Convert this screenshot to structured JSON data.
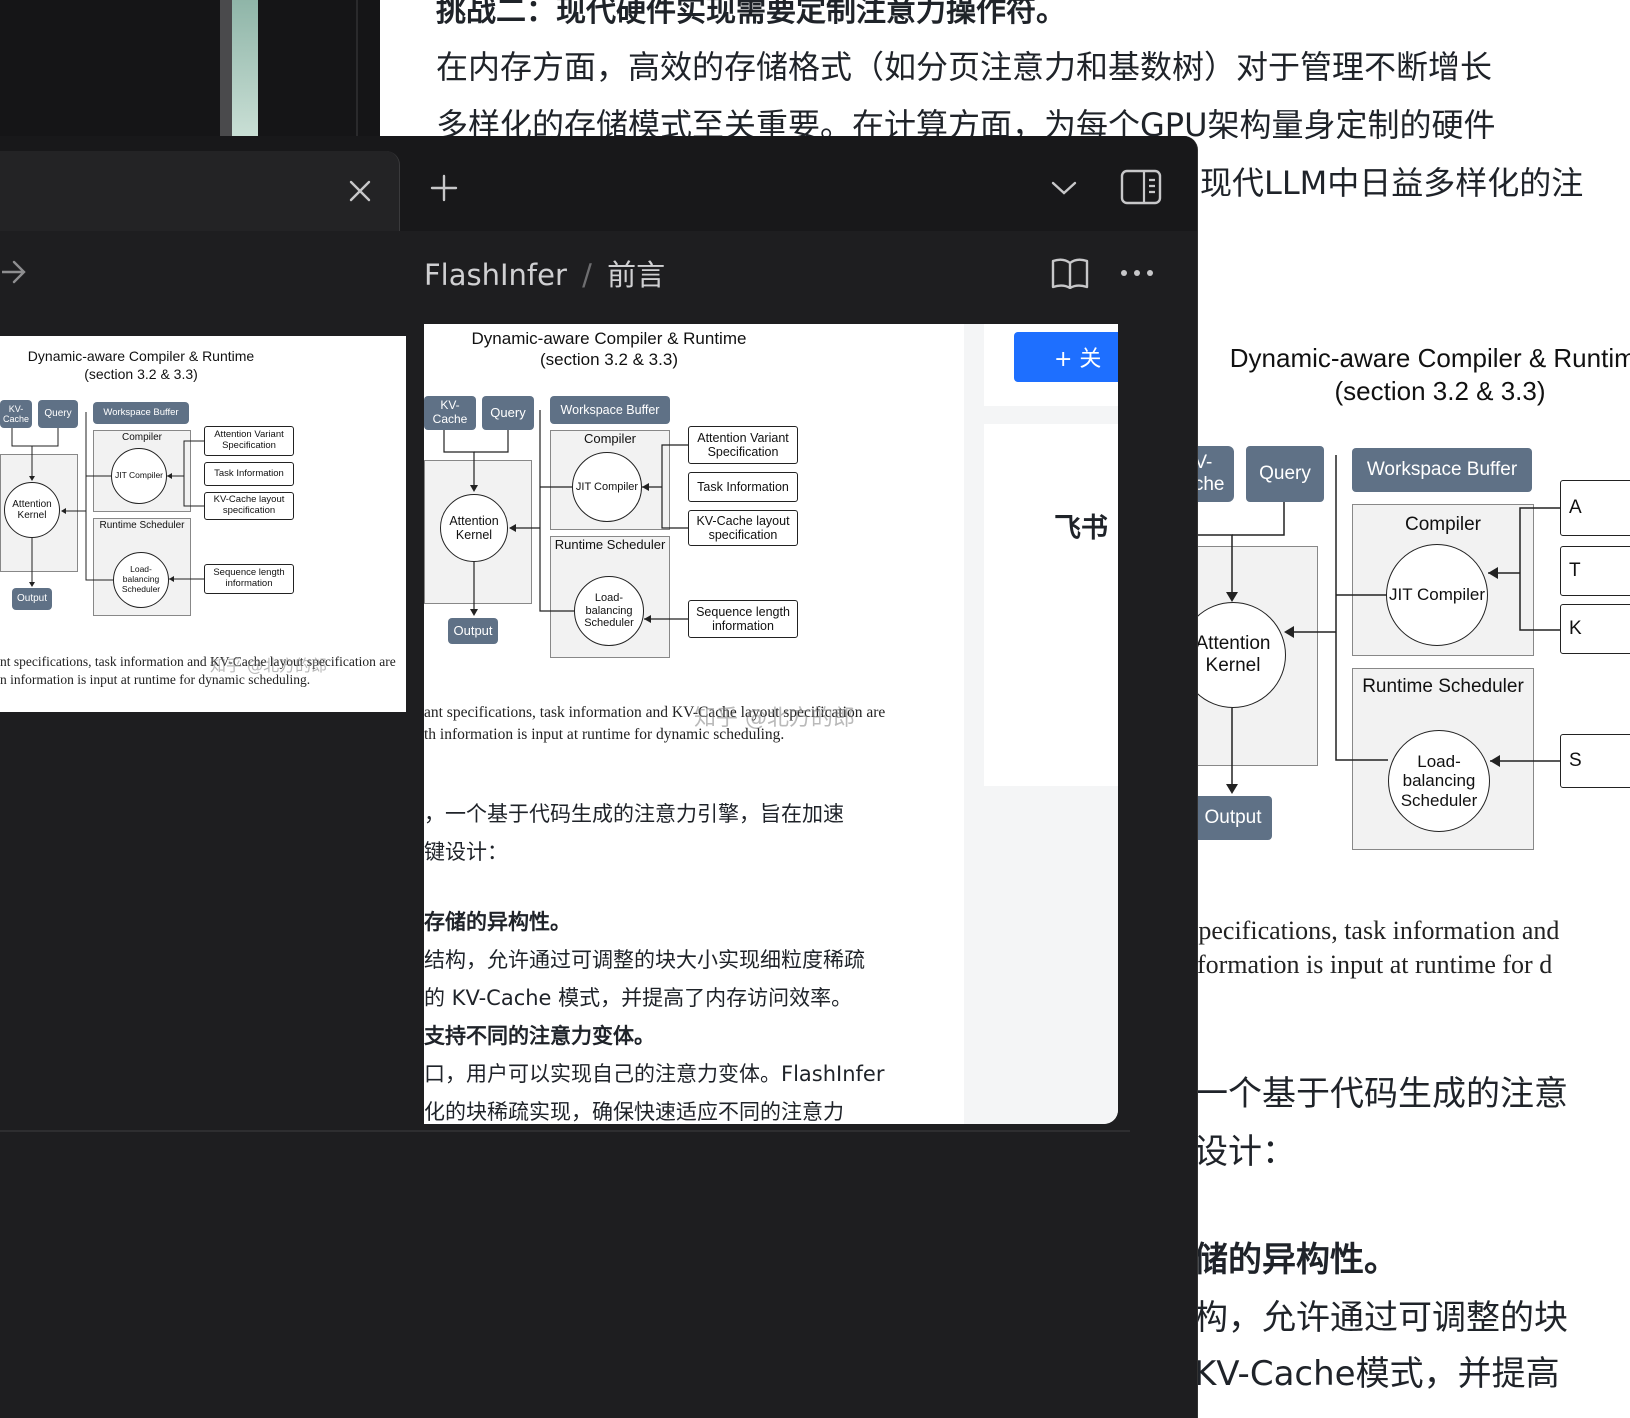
{
  "background": {
    "heading": "挑战二：现代硬件实现需要定制注意力操作符。",
    "para_line1": "在内存方面，高效的存储格式（如分页注意力和基数树）对于管理不断增长",
    "para_line2": "多样化的存储模式至关重要。在计算方面，为每个GPU架构量身定制的硬件",
    "para_line3": "现代LLM中日益多样化的注",
    "caption_line1": "ant specifications, task information and",
    "caption_line2": "th information is input at runtime for d",
    "body_line1": "，一个基于代码生成的注意",
    "body_line2": "键设计：",
    "bold_line": "存储的异构性。",
    "body_line3": "结构，允许通过可调整的块",
    "body_line4": "的KV-Cache模式，并提高"
  },
  "diagram": {
    "title_line1": "Dynamic-aware Compiler & Runtime",
    "title_line2": "(section 3.2 & 3.3)",
    "kv_cache": "KV-Cache",
    "query": "Query",
    "workspace_buffer": "Workspace Buffer",
    "compiler": "Compiler",
    "jit_compiler": "JIT Compiler",
    "attention_kernel": "Attention Kernel",
    "runtime_scheduler": "Runtime Scheduler",
    "load_balancing": "Load-balancing Scheduler",
    "output": "Output",
    "attention_variant": "Attention Variant Specification",
    "task_information": "Task Information",
    "kv_layout": "KV-Cache layout specification",
    "sequence_length": "Sequence length information"
  },
  "popup": {
    "breadcrumb_root": "FlashInfer",
    "breadcrumb_sep": "/",
    "breadcrumb_page": "前言",
    "follow_button": "+ 关",
    "feishu_label": "飞书",
    "watermark": "知乎 @北方的郎",
    "caption_line1": "ant specifications, task information and KV-Cache layout specification are",
    "caption_line2": "th information is input at runtime for dynamic scheduling.",
    "left_caption_line1": "nt specifications, task information and KV-Cache layout specification are",
    "left_caption_line2": "n information is input at runtime for dynamic scheduling.",
    "text_line1": "，一个基于代码生成的注意力引擎，旨在加速",
    "text_line2": "键设计：",
    "text_bold1": "存储的异构性。",
    "text_line3": "结构，允许通过可调整的块大小实现细粒度稀疏",
    "text_line4": "的 KV-Cache 模式，并提高了内存访问效率。",
    "text_bold2": "支持不同的注意力变体。",
    "text_line5": "口，用户可以实现自己的注意力变体。FlashInfer",
    "text_line6": "化的块稀疏实现，确保快速适应不同的注意力"
  },
  "icons": {
    "close": "close-icon",
    "new_tab": "plus-icon",
    "dropdown": "chevron-down-icon",
    "sidebar": "sidebar-toggle-icon",
    "forward": "arrow-right-icon",
    "reader": "book-icon",
    "more": "more-icon"
  },
  "colors": {
    "accent": "#1e6fff",
    "pill": "#5f7186",
    "dark_bg": "#1e1e20"
  }
}
